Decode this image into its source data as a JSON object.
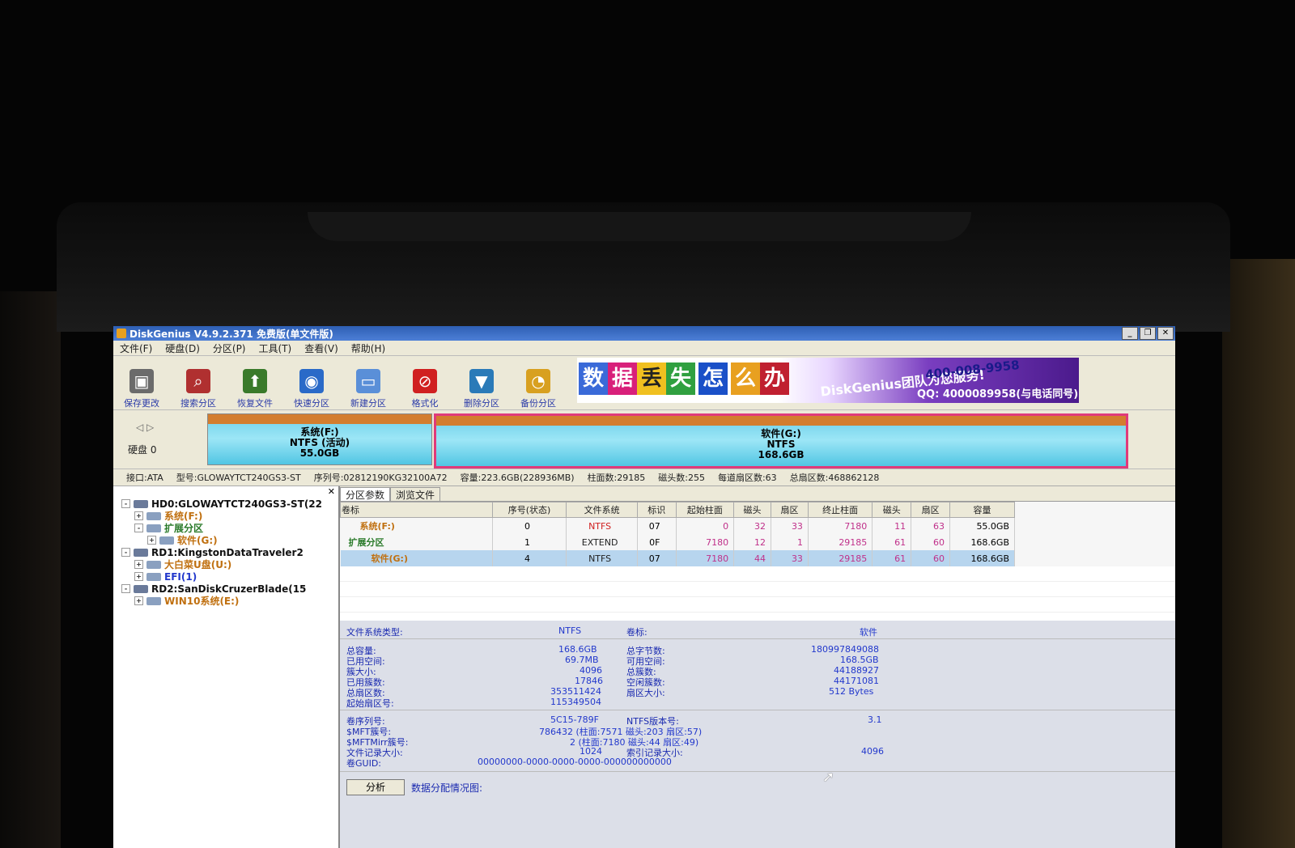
{
  "window": {
    "title": "DiskGenius V4.9.2.371 免费版(单文件版)",
    "controls": [
      "_",
      "❐",
      "✕"
    ]
  },
  "menu": [
    "文件(F)",
    "硬盘(D)",
    "分区(P)",
    "工具(T)",
    "查看(V)",
    "帮助(H)"
  ],
  "toolbar": [
    {
      "label": "保存更改",
      "icon": "save-icon",
      "color": "#6b6b6b"
    },
    {
      "label": "搜索分区",
      "icon": "search-icon",
      "color": "#b03030"
    },
    {
      "label": "恢复文件",
      "icon": "restore-icon",
      "color": "#3a7a2a"
    },
    {
      "label": "快速分区",
      "icon": "quick-partition-icon",
      "color": "#2a6ac8"
    },
    {
      "label": "新建分区",
      "icon": "new-partition-icon",
      "color": "#5a8fd8"
    },
    {
      "label": "格式化",
      "icon": "format-icon",
      "color": "#d02020"
    },
    {
      "label": "删除分区",
      "icon": "delete-partition-icon",
      "color": "#2a7ab8"
    },
    {
      "label": "备份分区",
      "icon": "backup-icon",
      "color": "#d8a020"
    }
  ],
  "banner": {
    "tiles": [
      "数",
      "据",
      "丢",
      "失",
      "怎",
      "么",
      "办"
    ],
    "brand": "DiskGenius团队为您服务!",
    "phone": "400-008-9958",
    "qq": "QQ: 4000089958(与电话同号)"
  },
  "diskmap": {
    "disk_label": "硬盘 0",
    "partitions": [
      {
        "name": "系统(F:)",
        "fs": "NTFS (活动)",
        "size": "55.0GB"
      },
      {
        "name": "软件(G:)",
        "fs": "NTFS",
        "size": "168.6GB"
      }
    ]
  },
  "diskinfo": {
    "interface": "接口:ATA",
    "model": "型号:GLOWAYTCT240GS3-ST",
    "serial": "序列号:02812190KG32100A72",
    "capacity": "容量:223.6GB(228936MB)",
    "cylinders": "柱面数:29185",
    "heads": "磁头数:255",
    "sectors_per_track": "每道扇区数:63",
    "total_sectors": "总扇区数:468862128"
  },
  "tree": [
    {
      "text": "HD0:GLOWAYTCT240GS3-ST(22",
      "level": 0,
      "exp": "-",
      "color": "#111"
    },
    {
      "text": "系统(F:)",
      "level": 1,
      "exp": "+",
      "color": "#c07010"
    },
    {
      "text": "扩展分区",
      "level": 1,
      "exp": "-",
      "color": "#2a7a2a"
    },
    {
      "text": "软件(G:)",
      "level": 2,
      "exp": "+",
      "color": "#c07010"
    },
    {
      "text": "RD1:KingstonDataTraveler2",
      "level": 0,
      "exp": "-",
      "color": "#111"
    },
    {
      "text": "大白菜U盘(U:)",
      "level": 1,
      "exp": "+",
      "color": "#c07010"
    },
    {
      "text": "EFI(1)",
      "level": 1,
      "exp": "+",
      "color": "#2238cc"
    },
    {
      "text": "RD2:SanDiskCruzerBlade(15",
      "level": 0,
      "exp": "-",
      "color": "#111"
    },
    {
      "text": "WIN10系统(E:)",
      "level": 1,
      "exp": "+",
      "color": "#c07010"
    }
  ],
  "tabs": [
    "分区参数",
    "浏览文件"
  ],
  "table": {
    "headers": [
      "卷标",
      "序号(状态)",
      "文件系统",
      "标识",
      "起始柱面",
      "磁头",
      "扇区",
      "终止柱面",
      "磁头",
      "扇区",
      "容量"
    ],
    "rows": [
      {
        "name": "系统(F:)",
        "no": "0",
        "fs": "NTFS",
        "id": "07",
        "sc": "0",
        "sh": "32",
        "ss": "33",
        "ec": "7180",
        "eh": "11",
        "es": "63",
        "size": "55.0GB",
        "name_color": "#c07010",
        "fs_color": "#d02020"
      },
      {
        "name": "扩展分区",
        "no": "1",
        "fs": "EXTEND",
        "id": "0F",
        "sc": "7180",
        "sh": "12",
        "ss": "1",
        "ec": "29185",
        "eh": "61",
        "es": "60",
        "size": "168.6GB",
        "name_color": "#2a7a2a",
        "fs_color": "#222"
      },
      {
        "name": "软件(G:)",
        "no": "4",
        "fs": "NTFS",
        "id": "07",
        "sc": "7180",
        "sh": "44",
        "ss": "33",
        "ec": "29185",
        "eh": "61",
        "es": "60",
        "size": "168.6GB",
        "name_color": "#c07010",
        "fs_color": "#222"
      }
    ]
  },
  "details": {
    "fs_type_label": "文件系统类型:",
    "fs_type": "NTFS",
    "volume_label_label": "卷标:",
    "volume_label": "软件",
    "total_capacity_label": "总容量:",
    "total_capacity": "168.6GB",
    "total_bytes_label": "总字节数:",
    "total_bytes": "180997849088",
    "used_label": "已用空间:",
    "used": "69.7MB",
    "free_label": "可用空间:",
    "free": "168.5GB",
    "cluster_size_label": "簇大小:",
    "cluster_size": "4096",
    "total_clusters_label": "总簇数:",
    "total_clusters": "44188927",
    "used_clusters_label": "已用簇数:",
    "used_clusters": "17846",
    "free_clusters_label": "空闲簇数:",
    "free_clusters": "44171081",
    "total_sectors_label": "总扇区数:",
    "total_sectors": "353511424",
    "sector_size_label": "扇区大小:",
    "sector_size": "512 Bytes",
    "start_sector_label": "起始扇区号:",
    "start_sector": "115349504",
    "serial_label": "卷序列号:",
    "serial": "5C15-789F",
    "ntfs_ver_label": "NTFS版本号:",
    "ntfs_ver": "3.1",
    "mft_label": "$MFT簇号:",
    "mft": "786432 (柱面:7571 磁头:203 扇区:57)",
    "mftmirr_label": "$MFTMirr簇号:",
    "mftmirr": "2 (柱面:7180 磁头:44 扇区:49)",
    "file_record_label": "文件记录大小:",
    "file_record": "1024",
    "index_record_label": "索引记录大小:",
    "index_record": "4096",
    "guid_label": "卷GUID:",
    "guid": "00000000-0000-0000-0000-000000000000",
    "analyze_button": "分析",
    "allocation_label": "数据分配情况图:"
  }
}
